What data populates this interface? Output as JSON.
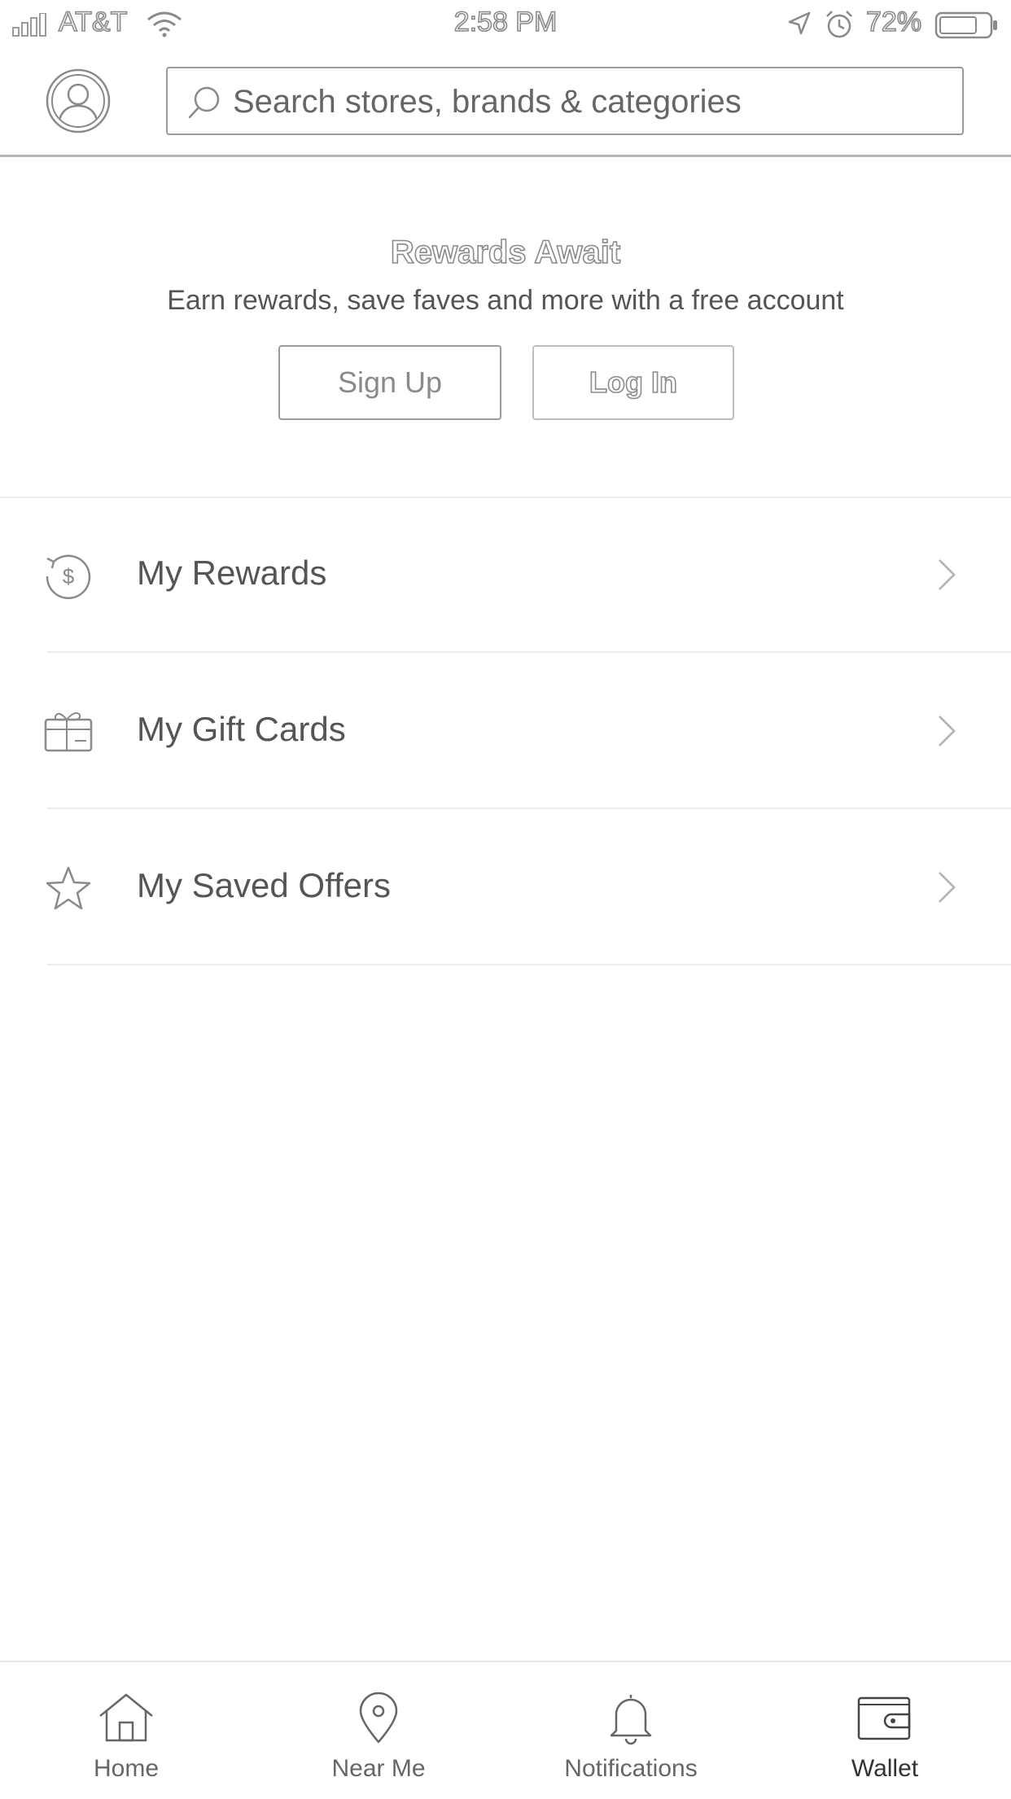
{
  "status_bar": {
    "carrier": "AT&T",
    "time": "2:58 PM",
    "battery_percent": "72%"
  },
  "header": {
    "search": {
      "placeholder": "Search stores, brands & categories",
      "value": ""
    }
  },
  "promo": {
    "title": "Rewards Await",
    "subtitle": "Earn rewards, save faves and more with a free account",
    "signup_label": "Sign Up",
    "login_label": "Log In"
  },
  "menu": {
    "items": [
      {
        "label": "My Rewards",
        "icon": "rewards-dollar-icon"
      },
      {
        "label": "My Gift Cards",
        "icon": "gift-card-icon"
      },
      {
        "label": "My Saved Offers",
        "icon": "star-icon"
      }
    ]
  },
  "tab_bar": {
    "tabs": [
      {
        "label": "Home",
        "icon": "home-icon"
      },
      {
        "label": "Near Me",
        "icon": "location-pin-icon"
      },
      {
        "label": "Notifications",
        "icon": "bell-icon"
      },
      {
        "label": "Wallet",
        "icon": "wallet-icon",
        "active": true
      }
    ]
  },
  "colors": {
    "text": "#555555",
    "border": "#9a9a9a",
    "divider": "#ececec",
    "background": "#ffffff"
  }
}
